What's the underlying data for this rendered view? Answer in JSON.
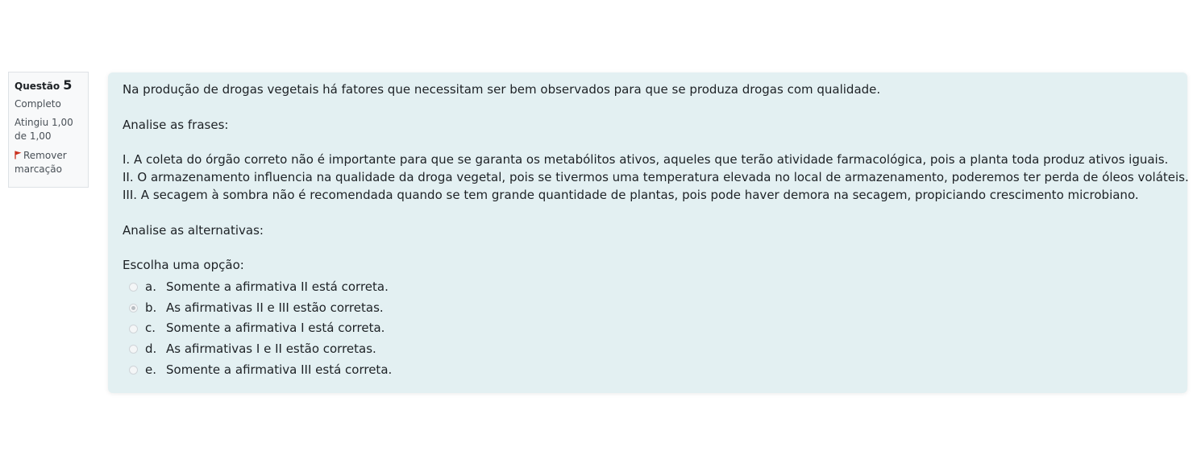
{
  "info": {
    "question_label": "Questão",
    "question_number": "5",
    "state": "Completo",
    "grade": "Atingiu 1,00 de 1,00",
    "flag_label": "Remover marcação"
  },
  "question": {
    "intro": "Na produção de drogas vegetais há fatores que necessitam ser bem observados para que se produza drogas com qualidade.",
    "analyse_phrases": "Analise as frases:",
    "statements": [
      "I. A coleta do órgão correto não é importante para que se garanta os metabólitos ativos, aqueles que terão atividade farmacológica, pois a planta toda produz ativos iguais.",
      "II. O armazenamento influencia na qualidade da droga vegetal, pois se tivermos uma temperatura elevada no local de armazenamento, poderemos ter perda de óleos voláteis.",
      "III. A secagem à sombra não é recomendada quando se tem grande quantidade de plantas, pois pode haver demora na secagem, propiciando crescimento microbiano."
    ],
    "analyse_alternatives": "Analise as alternativas:",
    "prompt": "Escolha uma opção:",
    "answers": [
      {
        "letter": "a.",
        "text": "Somente a afirmativa II está correta.",
        "selected": false
      },
      {
        "letter": "b.",
        "text": "As afirmativas II e III estão corretas.",
        "selected": true
      },
      {
        "letter": "c.",
        "text": "Somente a afirmativa I está correta.",
        "selected": false
      },
      {
        "letter": "d.",
        "text": "As afirmativas I e II estão corretas.",
        "selected": false
      },
      {
        "letter": "e.",
        "text": "Somente a afirmativa III está correta.",
        "selected": false
      }
    ]
  },
  "colors": {
    "content_bg": "#e3f0f2",
    "flag": "#ca3120"
  }
}
